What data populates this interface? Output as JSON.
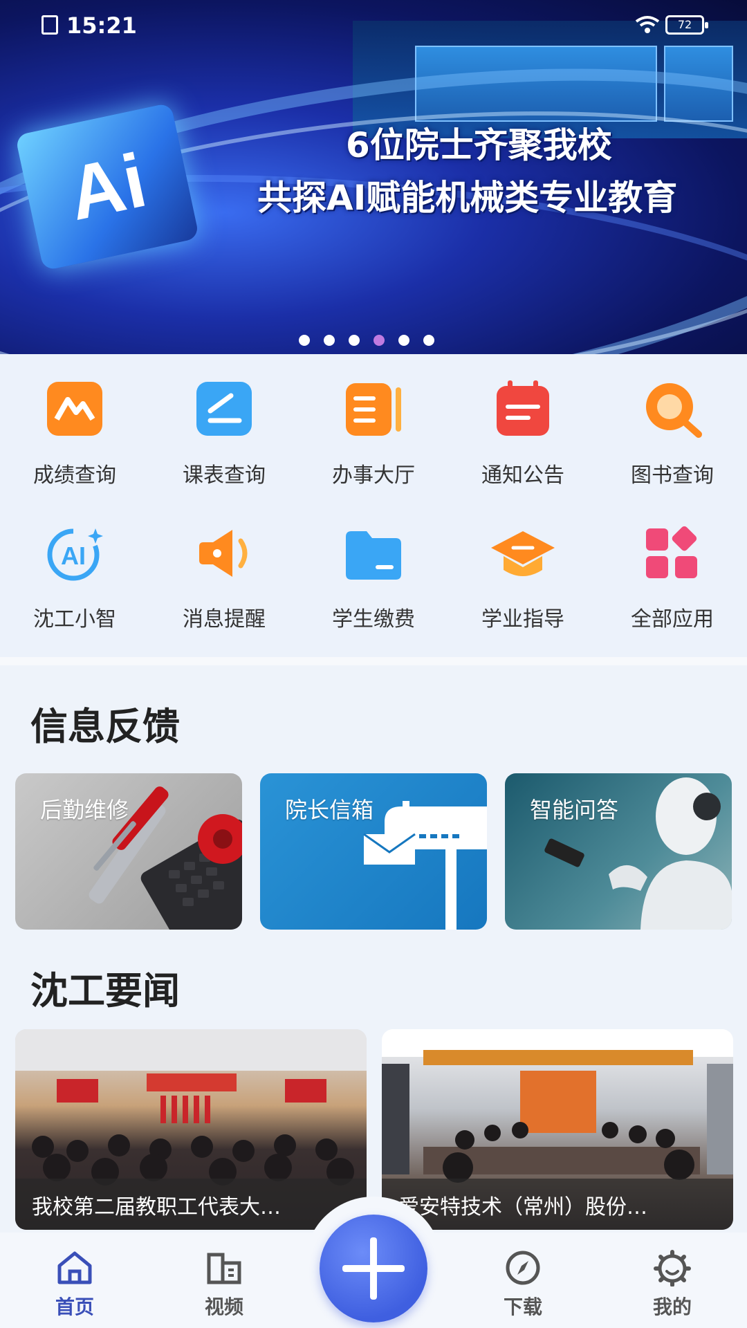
{
  "status_bar": {
    "time": "15:21",
    "battery": "72"
  },
  "banner": {
    "headline_line1": "6位院士齐聚我校",
    "headline_line2": "共探AI赋能机械类专业教育",
    "logo_text": "Ai",
    "active_dot": 4,
    "dot_count": 6
  },
  "apps": [
    {
      "label": "成绩查询",
      "icon": "chart-mountain-icon",
      "color": "#ff8a1f"
    },
    {
      "label": "课表查询",
      "icon": "schedule-pen-icon",
      "color": "#3aa6f5"
    },
    {
      "label": "办事大厅",
      "icon": "document-list-icon",
      "color": "#ff8a1f"
    },
    {
      "label": "通知公告",
      "icon": "calendar-notice-icon",
      "color": "#f0473f"
    },
    {
      "label": "图书查询",
      "icon": "search-magnifier-icon",
      "color": "#ff8a1f"
    },
    {
      "label": "沈工小智",
      "icon": "ai-assistant-icon",
      "color": "#3aa6f5"
    },
    {
      "label": "消息提醒",
      "icon": "speaker-icon",
      "color": "#ff8a1f"
    },
    {
      "label": "学生缴费",
      "icon": "folder-icon",
      "color": "#3aa6f5"
    },
    {
      "label": "学业指导",
      "icon": "graduation-cap-icon",
      "color": "#ff8a1f"
    },
    {
      "label": "全部应用",
      "icon": "all-apps-grid-icon",
      "color": "#f04a78"
    }
  ],
  "feedback": {
    "title": "信息反馈",
    "cards": [
      {
        "label": "后勤维修"
      },
      {
        "label": "院长信箱"
      },
      {
        "label": "智能问答"
      }
    ]
  },
  "news": {
    "title": "沈工要闻",
    "items": [
      {
        "caption": "我校第二届教职工代表大…"
      },
      {
        "caption": "爱安特技术（常州）股份…"
      }
    ]
  },
  "nav": {
    "items": [
      {
        "label": "首页",
        "icon": "home-icon",
        "active": true
      },
      {
        "label": "视频",
        "icon": "building-icon",
        "active": false
      },
      {
        "label": "下载",
        "icon": "compass-icon",
        "active": false
      },
      {
        "label": "我的",
        "icon": "profile-gear-icon",
        "active": false
      }
    ]
  }
}
